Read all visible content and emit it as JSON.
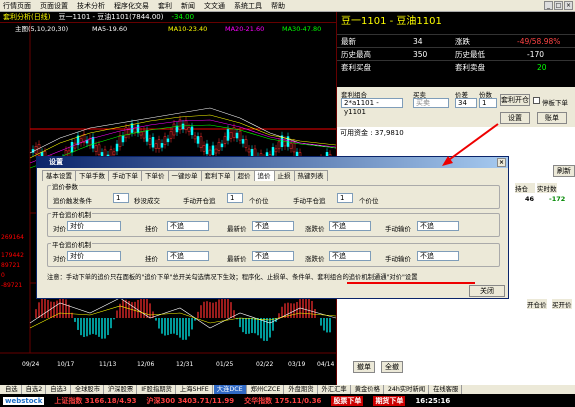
{
  "menu": [
    "行情页面",
    "页面设置",
    "技术分析",
    "程序化交易",
    "套利",
    "新闻",
    "文文通",
    "系统工具",
    "帮助"
  ],
  "chart": {
    "title": "套利分析(日线)",
    "legend": "豆一1101 - 豆油1101(7844.00)",
    "price_diff": "-34.00",
    "indicator": "主图(5,10,20,30)",
    "ma5": "MA5-19.60",
    "ma10": "MA10-23.40",
    "ma20": "MA20-21.60",
    "ma30": "MA30-47.80",
    "axis_left": [
      "269164",
      "179442",
      "89721",
      "0",
      "-89721"
    ],
    "x_dates": [
      "09/24",
      "10/17",
      "11/13",
      "12/06",
      "12/31",
      "01/25",
      "02/22",
      "03/19",
      "04/14"
    ],
    "colors": {
      "up": "#ff3030",
      "down": "#00ffff",
      "ma5": "#ffffff",
      "ma10": "#ffff00",
      "ma20": "#ff00ff",
      "ma30": "#00ff00"
    }
  },
  "quote": {
    "title": "豆一1101 - 豆油1101",
    "rows": [
      {
        "l1": "最新",
        "v1": "34",
        "l2": "涨跌",
        "v2": "-49/58.98%"
      },
      {
        "l1": "历史最高",
        "v1": "350",
        "l2": "历史最低",
        "v2": "-170"
      },
      {
        "l1": "套利买盘",
        "v1": "",
        "l2": "套利卖盘",
        "v2": "20"
      }
    ]
  },
  "form": {
    "combo_label": "套利组合",
    "combo_value": "2*a1101 - y1101",
    "buysell_label": "买卖",
    "buysell_value": "买卖",
    "price_label": "价差",
    "price_value": "34",
    "qty_label": "份数",
    "qty_value": "1",
    "open_btn": "套利开仓",
    "stop_label": "停板下单",
    "settings_btn": "设置",
    "account_btn": "账单"
  },
  "funds": "可用资金 : 37,9810",
  "right_cols": {
    "refresh": "刷新",
    "hold": "持仓",
    "today": "实时数",
    "v1": "46",
    "v2": "-172",
    "open_price": "开仓价",
    "buy_price": "买开价",
    "cancel": "撤单",
    "cancel_all": "全撤"
  },
  "dialog": {
    "title": "设置",
    "tabs": [
      "基本设置",
      "下单手数",
      "手动下单",
      "下单价",
      "一键炒单",
      "套利下单",
      "超价",
      "追价",
      "止损",
      "热键列表"
    ],
    "active_tab": 7,
    "g1": {
      "title": "追价参数",
      "l1": "追价触发条件",
      "v1": "1",
      "l1b": "秒没成交",
      "l2": "手动开仓追",
      "v2": "1",
      "l2b": "个价位",
      "l3": "手动平仓追",
      "v3": "1",
      "l3b": "个价位"
    },
    "g2": {
      "title": "开仓追价机制",
      "l1": "对价",
      "v1": "对价",
      "l2": "挂价",
      "v2": "不追",
      "l3": "最新价",
      "v3": "不追",
      "l4": "涨跌价",
      "v4": "不追",
      "l5": "手动输价",
      "v5": "不追"
    },
    "g3": {
      "title": "平仓追价机制",
      "l1": "对价",
      "v1": "对价",
      "l2": "挂价",
      "v2": "不追",
      "l3": "最新价",
      "v3": "不追",
      "l4": "涨跌价",
      "v4": "不追",
      "l5": "手动输价",
      "v5": "不追"
    },
    "note": "注意：手动下单的追价只在面板的\"追价下单\"总开关勾选情况下生效；程序化、止损单、条件单、套利组合的追价机制通通\"对价\"设置",
    "close_btn": "关闭"
  },
  "bottom_tabs": [
    "自选",
    "自选2",
    "自选3",
    "全球股市",
    "沪深股票",
    "IF股指期货",
    "上海SHFE",
    "大连DCE",
    "郑州CZCE",
    "外盘期货",
    "外汇汇率",
    "黄金价格",
    "24h实时新闻",
    "在线客服"
  ],
  "status": {
    "logo": "webstock",
    "idx1": "上证指数 3166.18/4.93",
    "idx2": "沪深300 3403.71/11.99",
    "idx3": "交华指数 175.11/0.36",
    "btn1": "股票下单",
    "btn2": "期货下单",
    "time": "16:25:16"
  }
}
